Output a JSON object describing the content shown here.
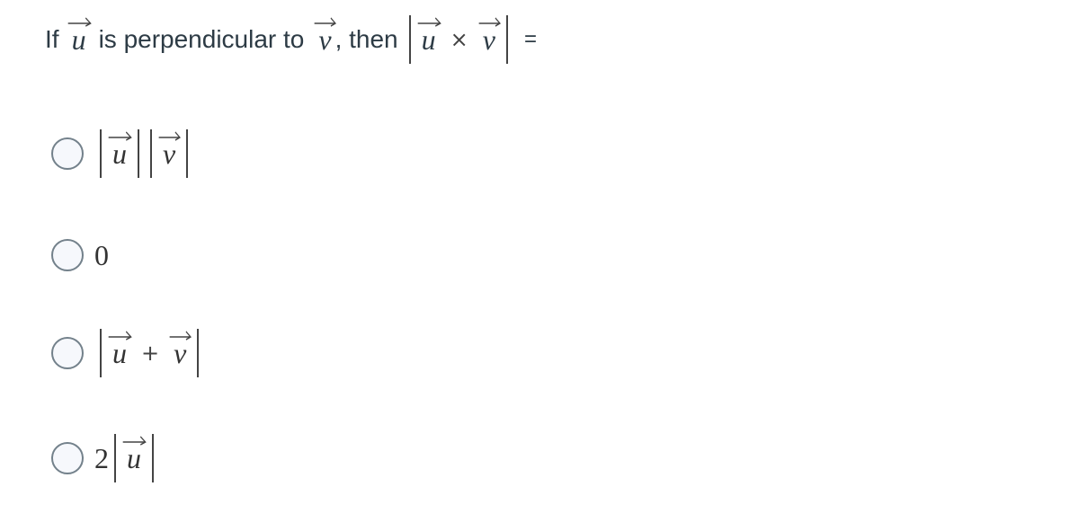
{
  "question": {
    "prefix": "If",
    "vec_u": "u",
    "middle": "is perpendicular to",
    "vec_v": "v",
    "then": ", then",
    "cross_symbol": "×",
    "equals": "="
  },
  "options": [
    {
      "id": "a",
      "parts": {
        "u": "u",
        "v": "v"
      },
      "description": "|u||v|",
      "selected": false
    },
    {
      "id": "b",
      "parts": {
        "value": "0"
      },
      "description": "0",
      "selected": false
    },
    {
      "id": "c",
      "parts": {
        "u": "u",
        "plus": "+",
        "v": "v"
      },
      "description": "|u + v|",
      "selected": false
    },
    {
      "id": "d",
      "parts": {
        "coef": "2",
        "u": "u"
      },
      "description": "2|u|",
      "selected": false
    }
  ],
  "colors": {
    "text": "#2d3b45",
    "radio_border": "#73818b",
    "radio_fill": "#f6f8fc"
  }
}
